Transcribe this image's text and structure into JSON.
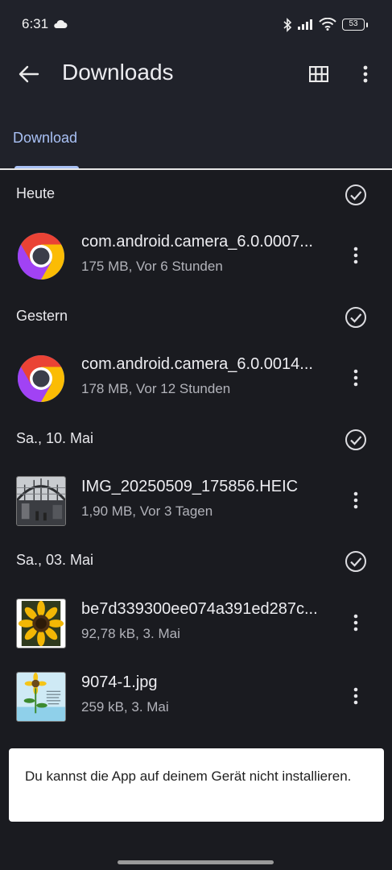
{
  "status_bar": {
    "time": "6:31",
    "battery": "53"
  },
  "app_bar": {
    "title": "Downloads"
  },
  "tabs": [
    {
      "label": "Download"
    }
  ],
  "sections": [
    {
      "title": "Heute",
      "items": [
        {
          "name": "com.android.camera_6.0.0007...",
          "meta": "175 MB, Vor 6 Stunden",
          "icon": "chrome-icon"
        }
      ]
    },
    {
      "title": "Gestern",
      "items": [
        {
          "name": "com.android.camera_6.0.0014...",
          "meta": "178 MB, Vor 12 Stunden",
          "icon": "chrome-icon"
        }
      ]
    },
    {
      "title": "Sa., 10. Mai",
      "items": [
        {
          "name": "IMG_20250509_175856.HEIC",
          "meta": "1,90 MB, Vor 3 Tagen",
          "icon": "photo-thumbnail"
        }
      ]
    },
    {
      "title": "Sa., 03. Mai",
      "items": [
        {
          "name": "be7d339300ee074a391ed287c...",
          "meta": "92,78 kB, 3. Mai",
          "icon": "sunflower-thumbnail"
        },
        {
          "name": "9074-1.jpg",
          "meta": "259 kB, 3. Mai",
          "icon": "sunflower-card-thumbnail"
        }
      ]
    }
  ],
  "toast": {
    "text": "Du kannst die App auf deinem Gerät nicht installieren."
  },
  "colors": {
    "background": "#1a1b20",
    "appbar": "#20222a",
    "accent": "#a9c1f5",
    "toast": "#ffffff"
  }
}
